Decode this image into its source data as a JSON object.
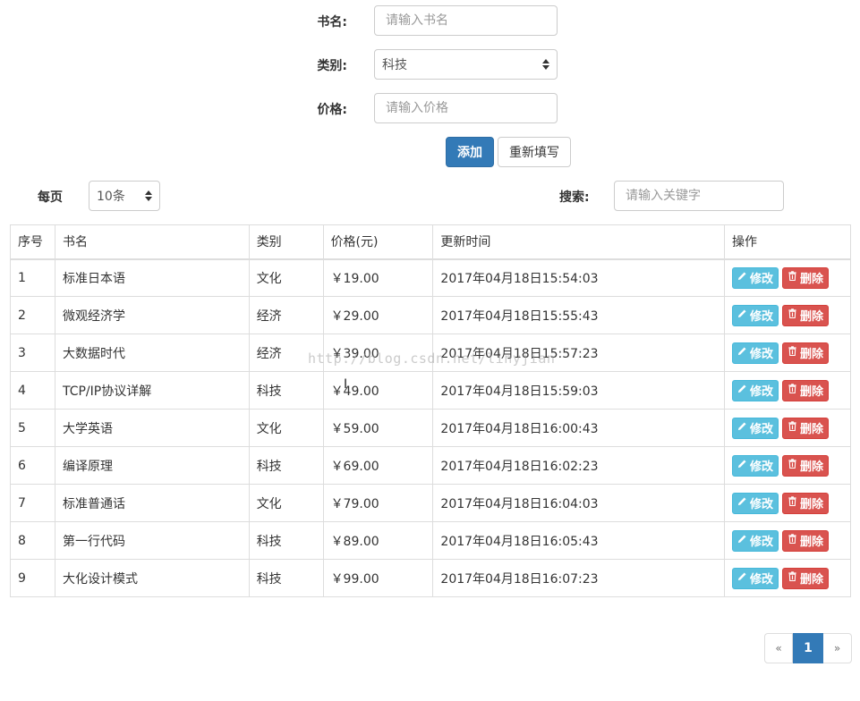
{
  "form": {
    "book_name": {
      "label": "书名:",
      "placeholder": "请输入书名"
    },
    "category": {
      "label": "类别:",
      "value": "科技"
    },
    "price": {
      "label": "价格:",
      "placeholder": "请输入价格"
    },
    "add_label": "添加",
    "reset_label": "重新填写"
  },
  "toolbar": {
    "per_page_label": "每页",
    "per_page_value": "10条",
    "search_label": "搜索:",
    "search_placeholder": "请输入关键字"
  },
  "table": {
    "headers": [
      "序号",
      "书名",
      "类别",
      "价格(元)",
      "更新时间",
      "操作"
    ],
    "edit_label": "修改",
    "delete_label": "删除",
    "rows": [
      [
        "1",
        "标准日本语",
        "文化",
        "￥19.00",
        "2017年04月18日15:54:03"
      ],
      [
        "2",
        "微观经济学",
        "经济",
        "￥29.00",
        "2017年04月18日15:55:43"
      ],
      [
        "3",
        "大数据时代",
        "经济",
        "￥39.00",
        "2017年04月18日15:57:23"
      ],
      [
        "4",
        "TCP/IP协议详解",
        "科技",
        "￥49.00",
        "2017年04月18日15:59:03"
      ],
      [
        "5",
        "大学英语",
        "文化",
        "￥59.00",
        "2017年04月18日16:00:43"
      ],
      [
        "6",
        "编译原理",
        "科技",
        "￥69.00",
        "2017年04月18日16:02:23"
      ],
      [
        "7",
        "标准普通话",
        "文化",
        "￥79.00",
        "2017年04月18日16:04:03"
      ],
      [
        "8",
        "第一行代码",
        "科技",
        "￥89.00",
        "2017年04月18日16:05:43"
      ],
      [
        "9",
        "大化设计模式",
        "科技",
        "￥99.00",
        "2017年04月18日16:07:23"
      ]
    ]
  },
  "watermark": "http://blog.csdn.net/linyjian",
  "pagination": {
    "prev": "«",
    "current": "1",
    "next": "»"
  },
  "colors": {
    "primary": "#337ab7",
    "info": "#5bc0de",
    "danger": "#d9534f"
  },
  "icons": {
    "edit": "pencil-icon",
    "delete": "trash-icon"
  }
}
